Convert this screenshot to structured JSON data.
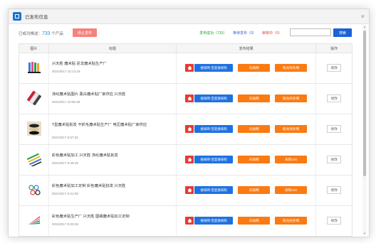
{
  "window": {
    "title": "已发布信息",
    "close": "×"
  },
  "toolbar": {
    "pushed_prefix": "已成功推送：",
    "pushed_count": "733",
    "pushed_suffix": " 个产品",
    "stop_label": "停止发布",
    "stat_success": "发布成功（733）",
    "stat_waiting": "等待发布（0）",
    "stat_failed": "审核中（0）",
    "search_placeholder": "",
    "search_label": "搜索"
  },
  "table": {
    "headers": {
      "image": "图片",
      "title": "标题",
      "result": "发布结果",
      "action": "操作"
    },
    "rows": [
      {
        "title": "兴天胜 魔术贴 尼龙魔术贴生产厂",
        "time": "2021/8/17 10:13:19",
        "red_icon": "home-icon",
        "blue": "搜采网-百度搜采购",
        "orange1": "天助网",
        "orange2": "链龙商务网",
        "edit": "修改",
        "thumb": "ribbons"
      },
      {
        "title": "涤纶魔术贴图片 黑白魔术贴厂家供应 兴天胜",
        "time": "2021/8/17 10:05:29",
        "red_icon": "home-icon",
        "blue": "搜采网-百度搜采购",
        "orange1": "天助网",
        "orange2": "链龙商务网",
        "edit": "修改",
        "thumb": "strips"
      },
      {
        "title": "T型魔术贴批发 不抓毛魔术贴生产厂 电压魔术贴厂家供应",
        "time": "2021/8/17 9:57:32",
        "red_icon": "home-icon",
        "blue": "搜采网-百度搜采购",
        "orange1": "天助网",
        "orange2": "链龙商务网",
        "edit": "修改",
        "thumb": "rolls"
      },
      {
        "title": "彩色魔术贴加工 兴天胜 涤纶魔术贴批发",
        "time": "2021/8/17 9:49:49",
        "red_icon": "home-icon",
        "blue": "搜采网-百度搜采购",
        "orange1": "天助网",
        "orange2": "采购100",
        "edit": "修改",
        "thumb": "colorstrips"
      },
      {
        "title": "彩色魔术贴加工定制 彩色魔术贴批发 兴天胜",
        "time": "2021/8/17 9:41:08",
        "red_icon": "home-icon",
        "blue": "搜采网-百度搜采购",
        "orange1": "天助网",
        "orange2": "采购100",
        "edit": "修改",
        "thumb": "loops"
      },
      {
        "title": "彩色魔术贴生产厂 兴天胜 圆绳魔术贴加工定制",
        "time": "2021/8/17 9:33:28",
        "red_icon": "home-icon",
        "blue": "搜采网-百度搜采购",
        "orange1": "天助网",
        "orange2": "链龙商务网",
        "edit": "修改",
        "thumb": "fan"
      }
    ]
  },
  "colors": {
    "accent_blue": "#2071e0",
    "orange": "#fb7a12",
    "red": "#e83a32",
    "success": "#2aa12a"
  }
}
